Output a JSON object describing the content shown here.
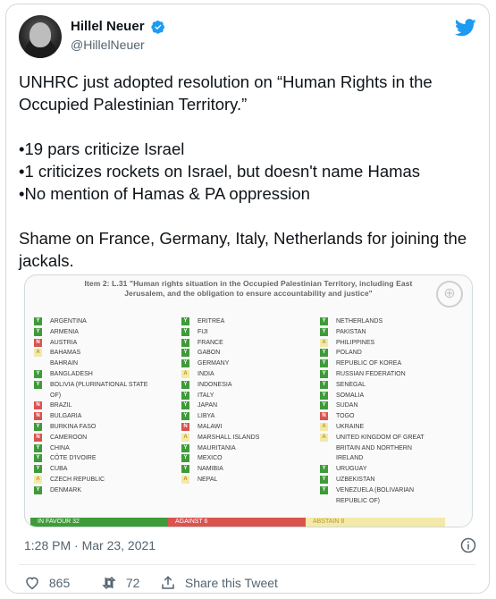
{
  "author": {
    "display_name": "Hillel Neuer",
    "handle": "@HillelNeuer",
    "verified": true
  },
  "tweet": {
    "paragraphs": [
      "UNHRC just adopted resolution on “Human Rights in the Occupied Palestinian Territory.”",
      "",
      "•1 9 pars criticize Israel",
      "•1 criticizes rockets on Israel, but doesn't name Hamas",
      "•No mention of Hamas & PA oppression",
      "",
      "Shame on France, Germany, Italy, Netherlands for joining the jackals."
    ],
    "timestamp": "1:28 PM · Mar 23, 2021"
  },
  "media": {
    "title_line1": "Item 2: L.31 \"Human rights situation in the Occupied Palestinian Territory, including East",
    "title_line2": "Jerusalem, and the obligation to ensure accountability and justice\"",
    "votes_col1": [
      {
        "v": "Y",
        "name": "ARGENTINA"
      },
      {
        "v": "Y",
        "name": "ARMENIA"
      },
      {
        "v": "N",
        "name": "AUSTRIA"
      },
      {
        "v": "A",
        "name": "BAHAMAS"
      },
      {
        "v": "",
        "name": "BAHRAIN"
      },
      {
        "v": "Y",
        "name": "BANGLADESH"
      },
      {
        "v": "Y",
        "name": "BOLIVIA (PLURINATIONAL STATE"
      },
      {
        "v": "",
        "name": "OF)"
      },
      {
        "v": "N",
        "name": "BRAZIL"
      },
      {
        "v": "N",
        "name": "BULGARIA"
      },
      {
        "v": "Y",
        "name": "BURKINA FASO"
      },
      {
        "v": "N",
        "name": "CAMEROON"
      },
      {
        "v": "Y",
        "name": "CHINA"
      },
      {
        "v": "Y",
        "name": "CÔTE D'IVOIRE"
      },
      {
        "v": "Y",
        "name": "CUBA"
      },
      {
        "v": "A",
        "name": "CZECH REPUBLIC"
      },
      {
        "v": "Y",
        "name": "DENMARK"
      }
    ],
    "votes_col2": [
      {
        "v": "Y",
        "name": "ERITREA"
      },
      {
        "v": "Y",
        "name": "FIJI"
      },
      {
        "v": "Y",
        "name": "FRANCE"
      },
      {
        "v": "Y",
        "name": "GABON"
      },
      {
        "v": "Y",
        "name": "GERMANY"
      },
      {
        "v": "A",
        "name": "INDIA"
      },
      {
        "v": "Y",
        "name": "INDONESIA"
      },
      {
        "v": "Y",
        "name": "ITALY"
      },
      {
        "v": "Y",
        "name": "JAPAN"
      },
      {
        "v": "Y",
        "name": "LIBYA"
      },
      {
        "v": "N",
        "name": "MALAWI"
      },
      {
        "v": "A",
        "name": "MARSHALL ISLANDS"
      },
      {
        "v": "Y",
        "name": "MAURITANIA"
      },
      {
        "v": "Y",
        "name": "MEXICO"
      },
      {
        "v": "Y",
        "name": "NAMIBIA"
      },
      {
        "v": "A",
        "name": "NEPAL"
      }
    ],
    "votes_col3": [
      {
        "v": "Y",
        "name": "NETHERLANDS"
      },
      {
        "v": "Y",
        "name": "PAKISTAN"
      },
      {
        "v": "A",
        "name": "PHILIPPINES"
      },
      {
        "v": "Y",
        "name": "POLAND"
      },
      {
        "v": "Y",
        "name": "REPUBLIC OF KOREA"
      },
      {
        "v": "Y",
        "name": "RUSSIAN FEDERATION"
      },
      {
        "v": "Y",
        "name": "SENEGAL"
      },
      {
        "v": "Y",
        "name": "SOMALIA"
      },
      {
        "v": "Y",
        "name": "SUDAN"
      },
      {
        "v": "N",
        "name": "TOGO"
      },
      {
        "v": "A",
        "name": "UKRAINE"
      },
      {
        "v": "A",
        "name": "UNITED KINGDOM OF GREAT"
      },
      {
        "v": "",
        "name": "BRITAIN AND NORTHERN"
      },
      {
        "v": "",
        "name": "IRELAND"
      },
      {
        "v": "Y",
        "name": "URUGUAY"
      },
      {
        "v": "Y",
        "name": "UZBEKISTAN"
      },
      {
        "v": "Y",
        "name": "VENEZUELA (BOLIVARIAN"
      },
      {
        "v": "",
        "name": "REPUBLIC OF)"
      }
    ],
    "tally": {
      "in_favour": "IN FAVOUR 32",
      "against": "AGAINST 6",
      "abstain": "ABSTAIN 8"
    }
  },
  "stats": {
    "likes": "865",
    "retweets": "72",
    "share_label": "Share this Tweet"
  },
  "colors": {
    "verified_blue": "#1d9bf0",
    "twitter_blue": "#1d9bf0",
    "yes_green": "#3f9b3a",
    "no_red": "#d9534f",
    "abstain_yellow": "#f3e9a8"
  },
  "icons": [
    "avatar",
    "verified-badge-icon",
    "twitter-bird-icon",
    "un-emblem-icon",
    "info-icon",
    "heart-icon",
    "retweet-icon",
    "share-icon"
  ]
}
